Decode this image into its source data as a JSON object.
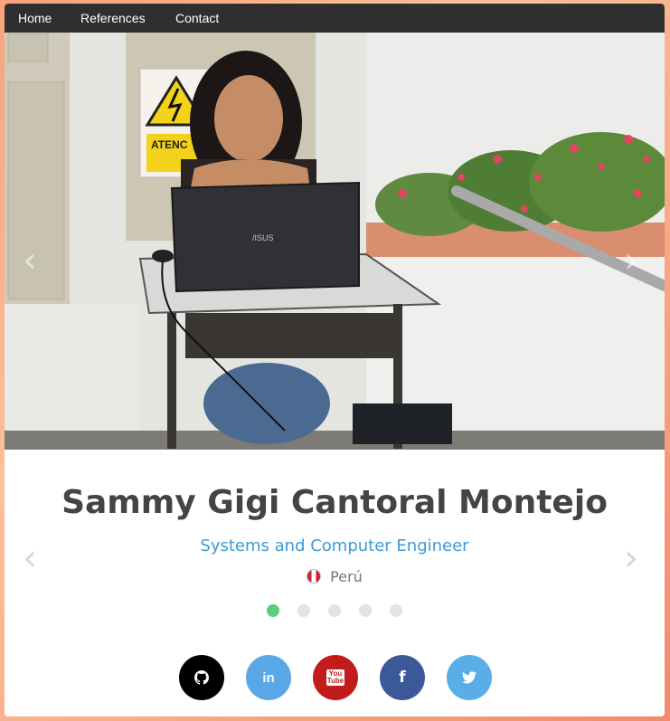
{
  "nav": {
    "items": [
      {
        "label": "Home"
      },
      {
        "label": "References"
      },
      {
        "label": "Contact"
      }
    ]
  },
  "carousel": {
    "prev_icon": "chevron-left-icon",
    "next_icon": "chevron-right-icon",
    "slide_count": 5,
    "active_index": 0,
    "active_color": "#5ccd7a",
    "inactive_color": "#e3e3e3"
  },
  "profile": {
    "name": "Sammy Gigi Cantoral Montejo",
    "title": "Systems and Computer Engineer",
    "location": "Perú",
    "location_icon": "peru-flag-icon"
  },
  "photo": {
    "laptop_brand": "/ISUS",
    "sign_text": "ATENC"
  },
  "social": [
    {
      "name": "github",
      "icon": "github-icon",
      "color": "#000000"
    },
    {
      "name": "linkedin",
      "icon": "linkedin-icon",
      "glyph": "in",
      "color": "#5aa7e8"
    },
    {
      "name": "youtube",
      "icon": "youtube-icon",
      "glyph": "You Tube",
      "color": "#c11b1b"
    },
    {
      "name": "facebook",
      "icon": "facebook-icon",
      "glyph": "f",
      "color": "#3b5998"
    },
    {
      "name": "twitter",
      "icon": "twitter-icon",
      "color": "#5aaee8"
    }
  ]
}
